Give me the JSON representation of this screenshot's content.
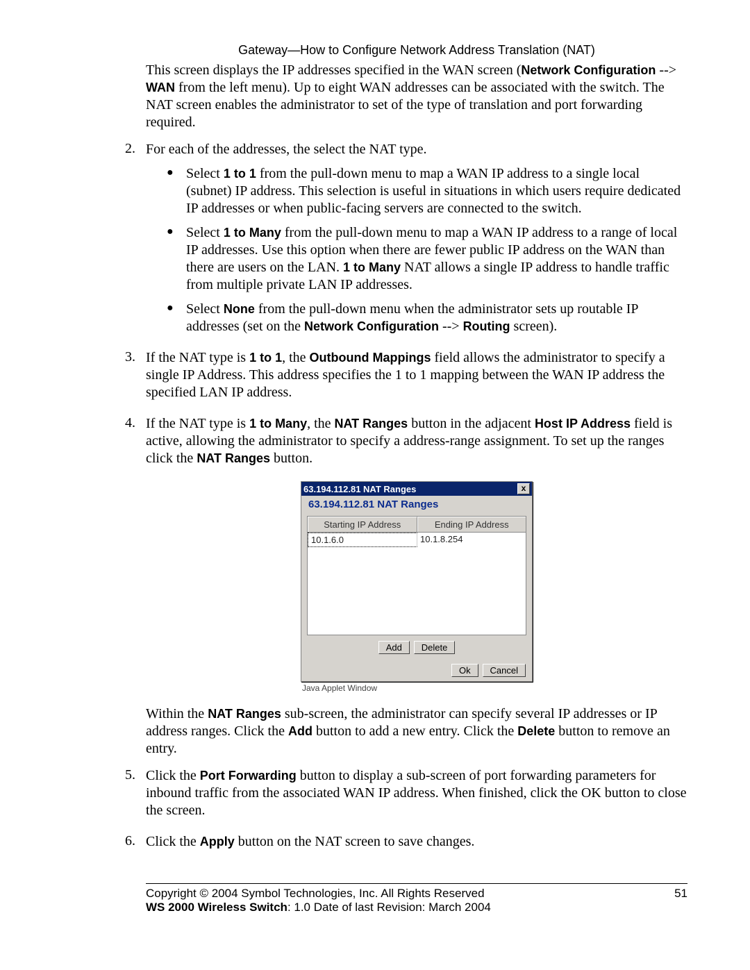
{
  "header": "Gateway—How to Configure Network Address Translation (NAT)",
  "p1": {
    "a": "This screen displays the IP addresses specified in the WAN screen (",
    "b1": "Network Configuration",
    "b": " --> ",
    "b2": "WAN",
    "c": " from the left menu). Up to eight WAN addresses can be associated with the switch. The NAT screen enables the administrator to set of the type of translation and port forwarding required."
  },
  "s2": {
    "num": "2.",
    "lead": "For each of the addresses, the select the NAT type.",
    "b1a": "Select ",
    "b1b": "1 to 1",
    "b1c": " from the pull-down menu to map a WAN IP address to a single local (subnet) IP address. This selection is useful in situations in which users require dedicated IP addresses or when public-facing servers are connected to the switch.",
    "b2a": "Select ",
    "b2b": "1 to Many",
    "b2c": " from the pull-down menu to map a WAN IP address to a range of local IP addresses. Use this option when there are fewer public IP address on the WAN than there are users on the LAN. ",
    "b2d": "1 to Many",
    "b2e": " NAT allows a single IP address to handle traffic from multiple private LAN IP addresses.",
    "b3a": "Select ",
    "b3b": "None",
    "b3c": " from the pull-down menu when the administrator sets up routable IP addresses (set on the ",
    "b3d": "Network Configuration",
    "b3e": " --> ",
    "b3f": "Routing",
    "b3g": " screen)."
  },
  "s3": {
    "num": "3.",
    "a": "If the NAT type is ",
    "b": "1 to 1",
    "c": ", the ",
    "d": "Outbound Mappings",
    "e": " field allows the administrator to specify a single IP Address. This address specifies the 1 to 1 mapping between the WAN IP address the specified LAN IP address."
  },
  "s4": {
    "num": "4.",
    "a": "If the NAT type is ",
    "b": "1 to Many",
    "c": ", the ",
    "d": "NAT Ranges",
    "e": " button in the adjacent ",
    "f": "Host IP Address",
    "g": " field is active, allowing the administrator to specify a address-range assignment. To set up the ranges click the ",
    "h": "NAT Ranges",
    "i": " button."
  },
  "dialog": {
    "title": "63.194.112.81 NAT Ranges",
    "close": "x",
    "subtitle": "63.194.112.81 NAT Ranges",
    "col1": "Starting IP Address",
    "col2": "Ending IP Address",
    "row1a": "10.1.6.0",
    "row1b": "10.1.8.254",
    "add": "Add",
    "delete": "Delete",
    "ok": "Ok",
    "cancel": "Cancel",
    "applet": "Java Applet Window"
  },
  "p5": {
    "a": "Within the ",
    "b": "NAT Ranges",
    "c": " sub-screen, the administrator can specify several IP addresses or IP address ranges. Click the ",
    "d": "Add",
    "e": " button to add a new entry. Click the ",
    "f": "Delete",
    "g": " button to remove an entry."
  },
  "s5": {
    "num": "5.",
    "a": "Click the ",
    "b": "Port Forwarding",
    "c": " button to display a sub-screen of port forwarding parameters for inbound traffic from the associated WAN IP address. When finished, click the OK button to close the screen."
  },
  "s6": {
    "num": "6.",
    "a": "Click the ",
    "b": "Apply",
    "c": " button on the NAT screen to save changes."
  },
  "footer": {
    "line1": "Copyright © 2004 Symbol Technologies, Inc. All Rights Reserved",
    "line2a": "WS 2000 Wireless Switch",
    "line2b": ": 1.0  Date of last Revision: March 2004",
    "page": "51"
  }
}
